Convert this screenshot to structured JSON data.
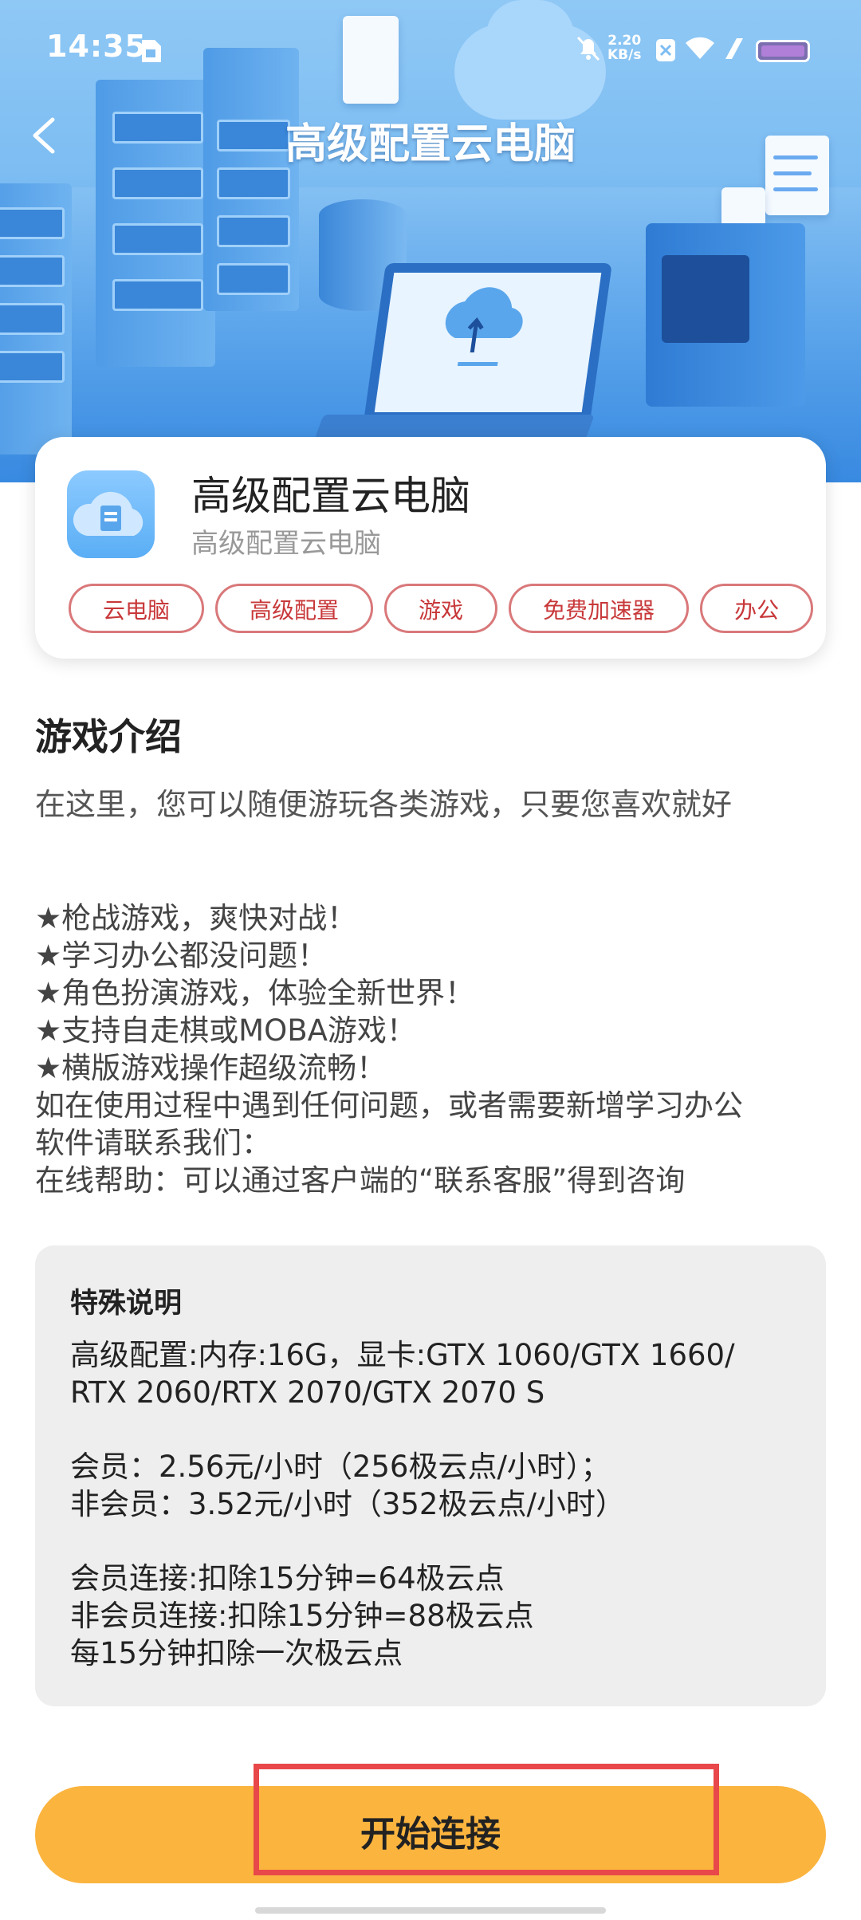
{
  "status_bar": {
    "time": "14:35",
    "net_speed_value": "2.20",
    "net_speed_unit": "KB/s"
  },
  "nav": {
    "title": "高级配置云电脑"
  },
  "app": {
    "name": "高级配置云电脑",
    "subtitle": "高级配置云电脑",
    "tags": [
      "云电脑",
      "高级配置",
      "游戏",
      "免费加速器",
      "办公"
    ]
  },
  "intro": {
    "title": "游戏介绍",
    "lead": "在这里，您可以随便游玩各类游戏，只要您喜欢就好",
    "lines": [
      "★枪战游戏，爽快对战！",
      "★学习办公都没问题！",
      "★角色扮演游戏，体验全新世界！",
      "★支持自走棋或MOBA游戏！",
      "★横版游戏操作超级流畅！",
      "如在使用过程中遇到任何问题，或者需要新增学习办公",
      "软件请联系我们：",
      "在线帮助：可以通过客户端的“联系客服”得到咨询"
    ]
  },
  "special": {
    "title": "特殊说明",
    "config_line1": "高级配置:内存:16G，显卡:GTX 1060/GTX 1660/",
    "config_line2": "RTX 2060/RTX 2070/GTX 2070 S",
    "member_price": "会员：2.56元/小时（256极云点/小时）；",
    "nonmember_price": "非会员：3.52元/小时（352极云点/小时）",
    "member_connect": "会员连接:扣除15分钟=64极云点",
    "nonmember_connect": "非会员连接:扣除15分钟=88极云点",
    "deduct_rule": "每15分钟扣除一次极云点"
  },
  "cta": {
    "label": "开始连接"
  },
  "colors": {
    "accent": "#fbb43e",
    "tag_border": "#d9787a",
    "tag_text": "#c8383a",
    "highlight": "#e8484a"
  }
}
